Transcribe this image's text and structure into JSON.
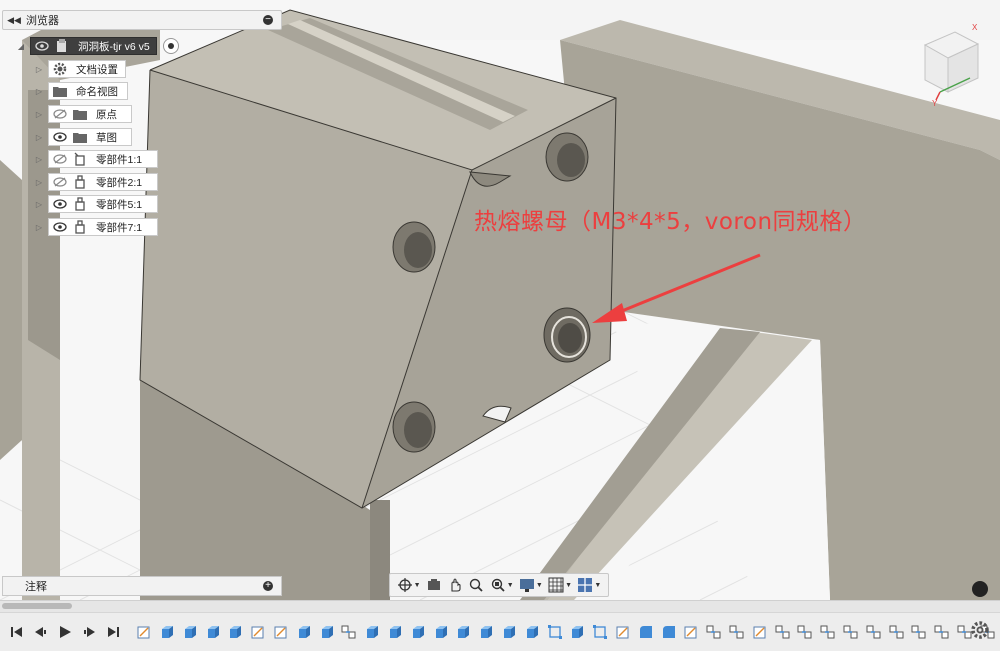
{
  "browser": {
    "title": "浏览器",
    "root": {
      "label": "洞洞板-tjr v6 v5"
    },
    "items": [
      {
        "label": "文档设置",
        "icon": "gear-icon",
        "eye": "none"
      },
      {
        "label": "命名视图",
        "icon": "folder-icon",
        "eye": "none"
      },
      {
        "label": "原点",
        "icon": "folder-icon",
        "eye": "hidden"
      },
      {
        "label": "草图",
        "icon": "folder-icon",
        "eye": "visible"
      },
      {
        "label": "零部件1:1",
        "icon": "component-link-icon",
        "eye": "hidden"
      },
      {
        "label": "零部件2:1",
        "icon": "component-icon",
        "eye": "hidden"
      },
      {
        "label": "零部件5:1",
        "icon": "component-icon",
        "eye": "visible"
      },
      {
        "label": "零部件7:1",
        "icon": "component-icon",
        "eye": "visible"
      }
    ]
  },
  "annotation": {
    "text": "热熔螺母（M3*4*5，voron同规格）",
    "color": "#ec3f3f"
  },
  "notes": {
    "title": "注释"
  },
  "viewcube": {
    "axis_x": "X",
    "axis_y": "Y"
  },
  "navbar": {
    "tools": [
      "orbit-icon",
      "look-at-icon",
      "pan-icon",
      "zoom-icon",
      "fit-icon",
      "display-settings-icon",
      "grid-icon",
      "viewports-icon"
    ]
  },
  "timeline": {
    "controls": [
      "go-to-start-icon",
      "step-back-icon",
      "play-icon",
      "step-forward-icon",
      "go-to-end-icon"
    ],
    "item_count": 38
  },
  "colors": {
    "model_face": "#b0aca1",
    "model_top": "#c1bdb2",
    "model_side": "#9a968c",
    "accent_annotation": "#ec3f3f"
  }
}
